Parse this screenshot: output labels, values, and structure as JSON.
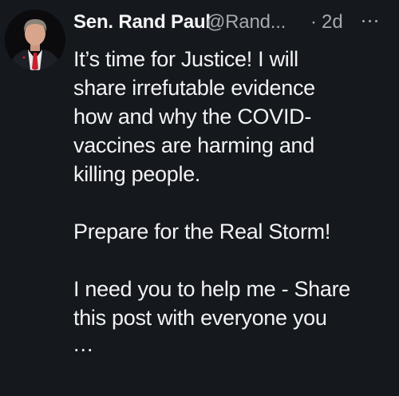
{
  "tweet": {
    "author": {
      "display_name": "Sen. Rand Paul",
      "handle": "@Rand...",
      "avatar_icon": "profile-photo"
    },
    "separator": "·",
    "timestamp": "2d",
    "more_icon": "more-horizontal-icon",
    "body": {
      "lines": [
        "It’s time for Justice! I will",
        "share irrefutable evidence",
        "how and why the COVID-",
        "vaccines are harming and",
        "killing people.",
        "",
        "Prepare for the Real Storm!",
        "",
        "I need you to help me - Share",
        "this post with everyone you"
      ],
      "truncation": "..."
    }
  },
  "colors": {
    "background": "#15181d",
    "primary_text": "#f2f3f4",
    "secondary_text": "#a4aab0"
  }
}
